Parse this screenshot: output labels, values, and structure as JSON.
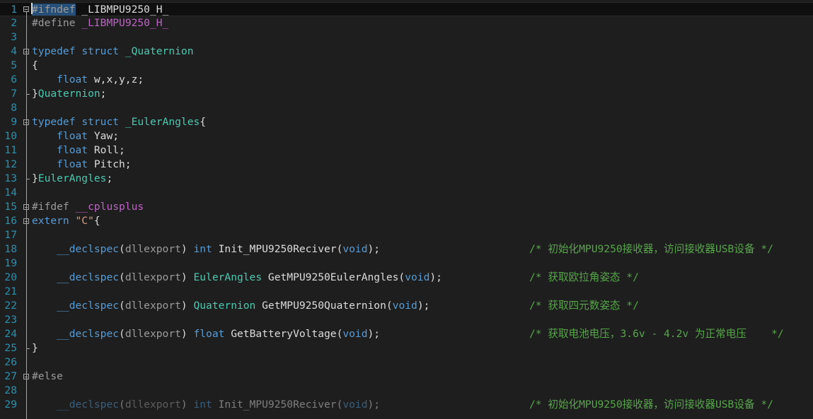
{
  "editor": {
    "language": "C",
    "current_line": 1,
    "lines": [
      {
        "n": "1",
        "tokens": [
          {
            "t": "#ifndef",
            "c": "pp sel"
          },
          {
            "t": " _LIBMPU9250_H_",
            "c": "txt"
          }
        ]
      },
      {
        "n": "2",
        "tokens": [
          {
            "t": "#define",
            "c": "pp"
          },
          {
            "t": " ",
            "c": "txt"
          },
          {
            "t": "_LIBMPU9250_H_",
            "c": "macro"
          }
        ]
      },
      {
        "n": "3",
        "tokens": []
      },
      {
        "n": "4",
        "tokens": [
          {
            "t": "typedef",
            "c": "kw"
          },
          {
            "t": " ",
            "c": "txt"
          },
          {
            "t": "struct",
            "c": "kw"
          },
          {
            "t": " ",
            "c": "txt"
          },
          {
            "t": "_Quaternion",
            "c": "type"
          }
        ]
      },
      {
        "n": "5",
        "tokens": [
          {
            "t": "{",
            "c": "txt"
          }
        ]
      },
      {
        "n": "6",
        "tokens": [
          {
            "t": "    ",
            "c": "txt"
          },
          {
            "t": "float",
            "c": "kw"
          },
          {
            "t": " w,x,y,z;",
            "c": "txt"
          }
        ]
      },
      {
        "n": "7",
        "tokens": [
          {
            "t": "}",
            "c": "txt"
          },
          {
            "t": "Quaternion",
            "c": "type"
          },
          {
            "t": ";",
            "c": "txt"
          }
        ]
      },
      {
        "n": "8",
        "tokens": []
      },
      {
        "n": "9",
        "tokens": [
          {
            "t": "typedef",
            "c": "kw"
          },
          {
            "t": " ",
            "c": "txt"
          },
          {
            "t": "struct",
            "c": "kw"
          },
          {
            "t": " ",
            "c": "txt"
          },
          {
            "t": "_EulerAngles",
            "c": "type"
          },
          {
            "t": "{",
            "c": "txt"
          }
        ]
      },
      {
        "n": "10",
        "tokens": [
          {
            "t": "    ",
            "c": "txt"
          },
          {
            "t": "float",
            "c": "kw"
          },
          {
            "t": " Yaw;",
            "c": "txt"
          }
        ]
      },
      {
        "n": "11",
        "tokens": [
          {
            "t": "    ",
            "c": "txt"
          },
          {
            "t": "float",
            "c": "kw"
          },
          {
            "t": " Roll;",
            "c": "txt"
          }
        ]
      },
      {
        "n": "12",
        "tokens": [
          {
            "t": "    ",
            "c": "txt"
          },
          {
            "t": "float",
            "c": "kw"
          },
          {
            "t": " Pitch;",
            "c": "txt"
          }
        ]
      },
      {
        "n": "13",
        "tokens": [
          {
            "t": "}",
            "c": "txt"
          },
          {
            "t": "EulerAngles",
            "c": "type"
          },
          {
            "t": ";",
            "c": "txt"
          }
        ]
      },
      {
        "n": "14",
        "tokens": []
      },
      {
        "n": "15",
        "tokens": [
          {
            "t": "#ifdef",
            "c": "pp"
          },
          {
            "t": " ",
            "c": "txt"
          },
          {
            "t": "__cplusplus",
            "c": "macro"
          }
        ]
      },
      {
        "n": "16",
        "tokens": [
          {
            "t": "extern",
            "c": "kw"
          },
          {
            "t": " ",
            "c": "txt"
          },
          {
            "t": "\"C\"",
            "c": "str"
          },
          {
            "t": "{",
            "c": "txt"
          }
        ]
      },
      {
        "n": "17",
        "tokens": []
      },
      {
        "n": "18",
        "tokens": [
          {
            "t": "    ",
            "c": "txt"
          },
          {
            "t": "__declspec",
            "c": "kw"
          },
          {
            "t": "(",
            "c": "txt"
          },
          {
            "t": "dllexport",
            "c": "pp"
          },
          {
            "t": ") ",
            "c": "txt"
          },
          {
            "t": "int",
            "c": "kw"
          },
          {
            "t": " Init_MPU9250Reciver(",
            "c": "txt"
          },
          {
            "t": "void",
            "c": "kw"
          },
          {
            "t": ");",
            "c": "txt"
          }
        ],
        "comment": "/* 初始化MPU9250接收器，访问接收器USB设备 */"
      },
      {
        "n": "19",
        "tokens": []
      },
      {
        "n": "20",
        "tokens": [
          {
            "t": "    ",
            "c": "txt"
          },
          {
            "t": "__declspec",
            "c": "kw"
          },
          {
            "t": "(",
            "c": "txt"
          },
          {
            "t": "dllexport",
            "c": "pp"
          },
          {
            "t": ") ",
            "c": "txt"
          },
          {
            "t": "EulerAngles",
            "c": "type"
          },
          {
            "t": " GetMPU9250EulerAngles(",
            "c": "txt"
          },
          {
            "t": "void",
            "c": "kw"
          },
          {
            "t": ");",
            "c": "txt"
          }
        ],
        "comment": "/* 获取欧拉角姿态 */"
      },
      {
        "n": "21",
        "tokens": []
      },
      {
        "n": "22",
        "tokens": [
          {
            "t": "    ",
            "c": "txt"
          },
          {
            "t": "__declspec",
            "c": "kw"
          },
          {
            "t": "(",
            "c": "txt"
          },
          {
            "t": "dllexport",
            "c": "pp"
          },
          {
            "t": ") ",
            "c": "txt"
          },
          {
            "t": "Quaternion",
            "c": "type"
          },
          {
            "t": " GetMPU9250Quaternion(",
            "c": "txt"
          },
          {
            "t": "void",
            "c": "kw"
          },
          {
            "t": ");",
            "c": "txt"
          }
        ],
        "comment": "/* 获取四元数姿态 */"
      },
      {
        "n": "23",
        "tokens": []
      },
      {
        "n": "24",
        "tokens": [
          {
            "t": "    ",
            "c": "txt"
          },
          {
            "t": "__declspec",
            "c": "kw"
          },
          {
            "t": "(",
            "c": "txt"
          },
          {
            "t": "dllexport",
            "c": "pp"
          },
          {
            "t": ") ",
            "c": "txt"
          },
          {
            "t": "float",
            "c": "kw"
          },
          {
            "t": " GetBatteryVoltage(",
            "c": "txt"
          },
          {
            "t": "void",
            "c": "kw"
          },
          {
            "t": ");",
            "c": "txt"
          }
        ],
        "comment": "/* 获取电池电压，3.6v - 4.2v 为正常电压    */"
      },
      {
        "n": "25",
        "tokens": [
          {
            "t": "}",
            "c": "txt"
          }
        ]
      },
      {
        "n": "26",
        "tokens": []
      },
      {
        "n": "27",
        "tokens": [
          {
            "t": "#else",
            "c": "pp"
          }
        ]
      },
      {
        "n": "28",
        "tokens": []
      },
      {
        "n": "29",
        "dim": true,
        "tokens": [
          {
            "t": "    ",
            "c": "txt"
          },
          {
            "t": "__declspec",
            "c": "kw"
          },
          {
            "t": "(",
            "c": "txt"
          },
          {
            "t": "dllexport",
            "c": "pp"
          },
          {
            "t": ") ",
            "c": "txt"
          },
          {
            "t": "int",
            "c": "kw"
          },
          {
            "t": " Init_MPU9250Reciver(",
            "c": "txt"
          },
          {
            "t": "void",
            "c": "kw"
          },
          {
            "t": ");",
            "c": "txt"
          }
        ],
        "comment": "/* 初始化MPU9250接收器，访问接收器USB设备 */"
      }
    ],
    "fold_markers": [
      1,
      4,
      9,
      15,
      16,
      27
    ]
  }
}
